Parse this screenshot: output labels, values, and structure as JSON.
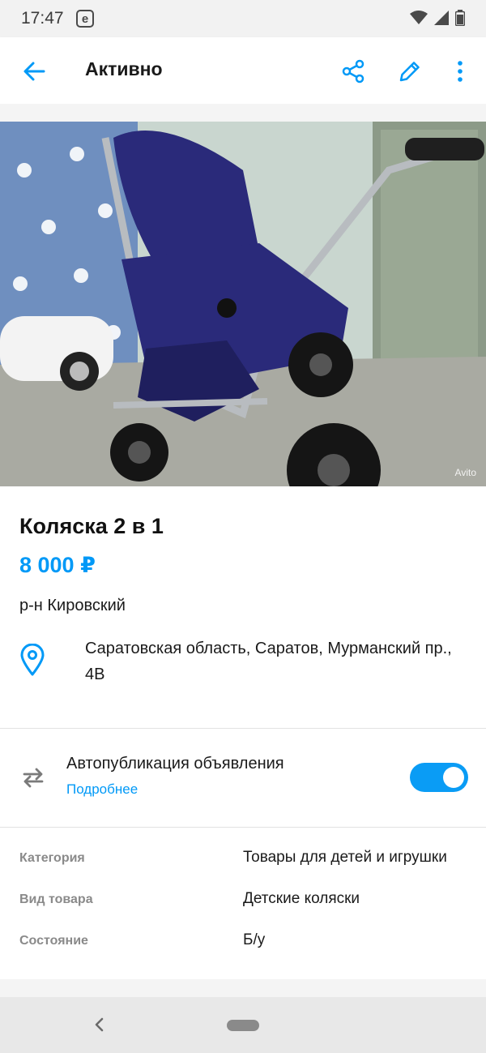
{
  "status_bar": {
    "time": "17:47",
    "app_badge": "e"
  },
  "app_bar": {
    "title": "Активно"
  },
  "photo": {
    "watermark": "Avito"
  },
  "listing": {
    "title": "Коляска 2 в 1",
    "price": "8 000 ₽",
    "district": "р-н Кировский",
    "address": "Саратовская область, Саратов, Мурманский пр., 4В"
  },
  "autopublish": {
    "label": "Автопубликация объявления",
    "more_link": "Подробнее",
    "enabled": true
  },
  "params": [
    {
      "label": "Категория",
      "value": "Товары для детей и игрушки"
    },
    {
      "label": "Вид товара",
      "value": "Детские коляски"
    },
    {
      "label": "Состояние",
      "value": "Б/у"
    }
  ],
  "colors": {
    "accent": "#0099f7",
    "toggle": "#0a9cf5",
    "stroller": "#2a2a7a"
  },
  "icons": {
    "back": "arrow-left-icon",
    "share": "share-icon",
    "edit": "pencil-icon",
    "more": "more-vertical-icon",
    "location": "map-pin-icon",
    "autopublish": "repeat-icon"
  }
}
